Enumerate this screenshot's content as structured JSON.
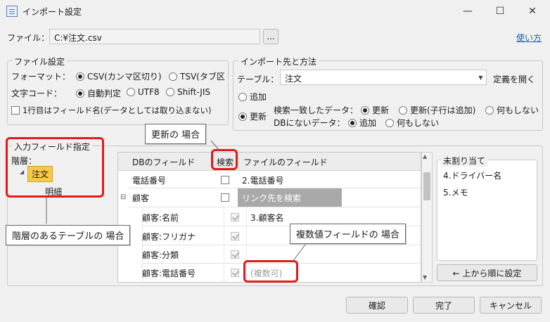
{
  "window": {
    "title": "インポート設定",
    "minimize_icon": "minimize-icon",
    "maximize_icon": "maximize-icon",
    "close_icon": "close-icon"
  },
  "file": {
    "label": "ファイル：",
    "path": "C:¥注文.csv",
    "browse_label": "...",
    "help_link": "使い方"
  },
  "file_settings": {
    "title": "ファイル設定",
    "format_label": "フォーマット：",
    "format_options": [
      "CSV(カンマ区切り)",
      "TSV(タブ区"
    ],
    "format_selected": 0,
    "encoding_label": "文字コード：",
    "encoding_options": [
      "自動判定",
      "UTF8",
      "Shift-JIS"
    ],
    "encoding_selected": 0,
    "header_row_label": "1行目はフィールド名(データとしては取り込まない)",
    "header_row_checked": false
  },
  "import_target": {
    "title": "インポート先と方法",
    "table_label": "テーブル：",
    "table_value": "注文",
    "define_link": "定義を開く",
    "mode_add": "追加",
    "mode_update": "更新",
    "mode_selected": "update",
    "match_label": "検索一致したデータ：",
    "match_options": [
      "更新",
      "更新(子行は追加)",
      "何もしない"
    ],
    "match_selected": 0,
    "nomatch_label": "DBにないデータ：",
    "nomatch_options": [
      "追加",
      "何もしない"
    ],
    "nomatch_selected": 0
  },
  "input_fields": {
    "title": "入力フィールド指定",
    "hierarchy_label": "階層：",
    "tree": [
      {
        "label": "注文",
        "selected": true
      },
      {
        "label": "明細",
        "selected": false
      }
    ],
    "grid": {
      "headers": [
        "DBのフィールド",
        "検索",
        "ファイルのフィールド"
      ],
      "rows": [
        {
          "db": "電話番号",
          "search": false,
          "file": "2.電話番号",
          "indent": 0,
          "enabled": true
        },
        {
          "db": "顧客",
          "search": false,
          "file": "リンク先を検索",
          "indent": 0,
          "enabled": true,
          "group": true,
          "file_style": "gray"
        },
        {
          "db": "顧客:名前",
          "search": true,
          "file": "3.顧客名",
          "indent": 1,
          "enabled": false
        },
        {
          "db": "顧客:フリガナ",
          "search": true,
          "file": "",
          "indent": 1,
          "enabled": false
        },
        {
          "db": "顧客:分類",
          "search": true,
          "file": "",
          "indent": 1,
          "enabled": false
        },
        {
          "db": "顧客:電話番号",
          "search": true,
          "file": "(複数可)",
          "indent": 1,
          "enabled": false,
          "file_style": "muted"
        }
      ]
    },
    "unassigned_title": "未割り当て",
    "unassigned": [
      "4.ドライバー名",
      "5.メモ"
    ],
    "auto_assign_label": "← 上から順に設定"
  },
  "callouts": {
    "update": "更新の 場合",
    "hierarchy": "階層のあるテーブルの 場合",
    "multi": "複数値フィールドの 場合"
  },
  "footer": {
    "confirm": "確認",
    "done": "完了",
    "cancel": "キャンセル"
  }
}
